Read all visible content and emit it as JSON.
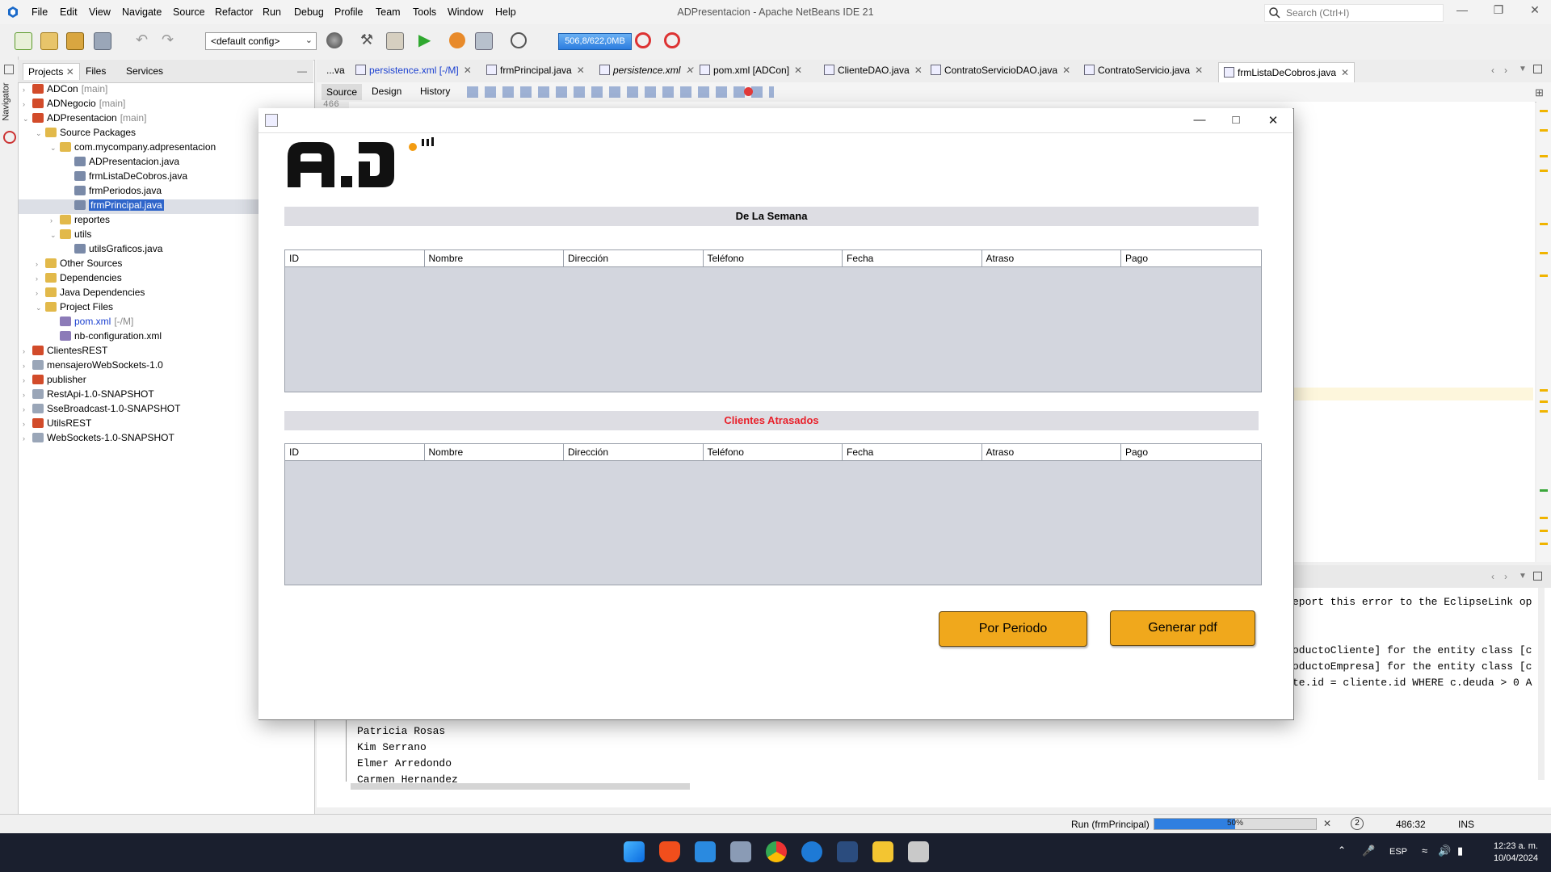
{
  "app": {
    "window_title": "ADPresentacion - Apache NetBeans IDE 21",
    "menu": [
      "File",
      "Edit",
      "View",
      "Navigate",
      "Source",
      "Refactor",
      "Run",
      "Debug",
      "Profile",
      "Team",
      "Tools",
      "Window",
      "Help"
    ],
    "search_placeholder": "Search (Ctrl+I)"
  },
  "toolbar": {
    "config": "<default config>",
    "memory": "506,8/622,0MB"
  },
  "left": {
    "navigator_label": "Navigator",
    "tabs": [
      "Projects",
      "Files",
      "Services"
    ],
    "tree": [
      {
        "label": "ADCon",
        "suffix": "[main]"
      },
      {
        "label": "ADNegocio",
        "suffix": "[main]"
      },
      {
        "label": "ADPresentacion",
        "suffix": "[main]"
      },
      {
        "label": "Source Packages",
        "suffix": ""
      },
      {
        "label": "com.mycompany.adpresentacion",
        "suffix": ""
      },
      {
        "label": "ADPresentacion.java",
        "suffix": ""
      },
      {
        "label": "frmListaDeCobros.java",
        "suffix": ""
      },
      {
        "label": "frmPeriodos.java",
        "suffix": ""
      },
      {
        "label": "frmPrincipal.java",
        "suffix": ""
      },
      {
        "label": "reportes",
        "suffix": ""
      },
      {
        "label": "utils",
        "suffix": ""
      },
      {
        "label": "utilsGraficos.java",
        "suffix": ""
      },
      {
        "label": "Other Sources",
        "suffix": ""
      },
      {
        "label": "Dependencies",
        "suffix": ""
      },
      {
        "label": "Java Dependencies",
        "suffix": ""
      },
      {
        "label": "Project Files",
        "suffix": ""
      },
      {
        "label": "pom.xml",
        "suffix": "[-/M]"
      },
      {
        "label": "nb-configuration.xml",
        "suffix": ""
      },
      {
        "label": "ClientesREST",
        "suffix": ""
      },
      {
        "label": "mensajeroWebSockets-1.0",
        "suffix": ""
      },
      {
        "label": "publisher",
        "suffix": ""
      },
      {
        "label": "RestApi-1.0-SNAPSHOT",
        "suffix": ""
      },
      {
        "label": "SseBroadcast-1.0-SNAPSHOT",
        "suffix": ""
      },
      {
        "label": "UtilsREST",
        "suffix": ""
      },
      {
        "label": "WebSockets-1.0-SNAPSHOT",
        "suffix": ""
      }
    ]
  },
  "editor": {
    "tabs": [
      "...va",
      "persistence.xml [-/M]",
      "frmPrincipal.java",
      "persistence.xml",
      "pom.xml [ADCon]",
      "ClienteDAO.java",
      "ContratoServicioDAO.java",
      "ContratoServicio.java",
      "frmListaDeCobros.java"
    ],
    "subtabs": [
      "Source",
      "Design",
      "History"
    ],
    "gutter_line": "466"
  },
  "output": {
    "right_lines": [
      "eport this error to the EclipseLink op",
      "oductoCliente] for the entity class [c",
      "oductoEmpresa] for the entity class [c",
      "te.id = cliente.id WHERE c.deuda > 0 A"
    ],
    "names": [
      "Patricia Rosas",
      "Kim Serrano",
      "Elmer Arredondo",
      "Carmen Hernandez"
    ]
  },
  "status": {
    "run_label": "Run (frmPrincipal)",
    "progress_pct": 50,
    "progress_text": "50%",
    "position": "486:32",
    "mode": "INS"
  },
  "taskbar": {
    "lang": "ESP",
    "time": "12:23 a. m.",
    "date": "10/04/2024"
  },
  "dialog": {
    "section1_title": "De La Semana",
    "section2_title": "Clientes Atrasados",
    "columns": [
      "ID",
      "Nombre",
      "Dirección",
      "Teléfono",
      "Fecha",
      "Atraso",
      "Pago"
    ],
    "btn_periodo": "Por Periodo",
    "btn_pdf": "Generar pdf",
    "section2_color": "#e8202a",
    "accent": "#f0a81c"
  }
}
